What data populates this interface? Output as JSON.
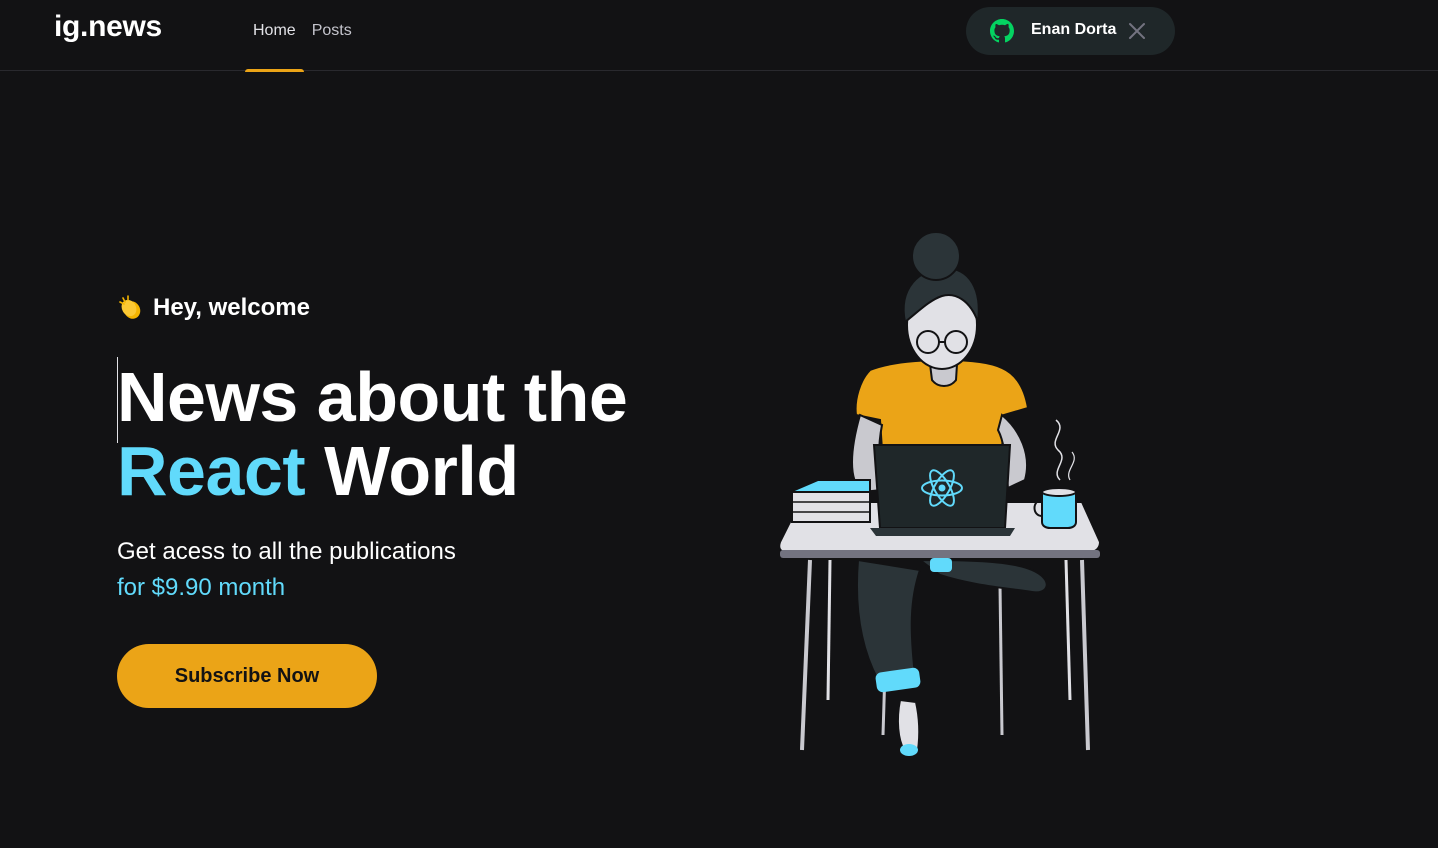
{
  "header": {
    "logo": "ig.news",
    "nav": [
      {
        "label": "Home",
        "active": true
      },
      {
        "label": "Posts",
        "active": false
      }
    ],
    "signin": {
      "user_name": "Enan Dorta",
      "icon": "github-icon",
      "close_icon": "close-icon"
    }
  },
  "hero": {
    "welcome": "Hey, welcome",
    "welcome_icon": "clapping-hands-icon",
    "title_line1": "News about the",
    "title_accent": "React",
    "title_line2_rest": "World",
    "description": "Get acess to all the publications",
    "price": "for $9.90 month",
    "subscribe_label": "Subscribe Now"
  },
  "illustration": {
    "name": "woman-with-laptop-illustration",
    "laptop_logo": "react-logo-icon"
  },
  "colors": {
    "background": "#121214",
    "accent_yellow": "#eba417",
    "react_cyan": "#61dafb",
    "github_green": "#04d361"
  }
}
